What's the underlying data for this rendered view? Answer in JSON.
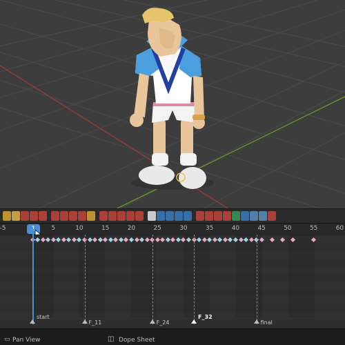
{
  "app": "Blender",
  "viewport": {
    "character": "cartoon man with blond quiff, blue collared polo with white V stripe, white shorts, white sneakers"
  },
  "toolbar": {
    "groups": [
      [
        "lock-icon",
        "key-icon",
        "curve-icon",
        "curve-icon",
        "wave-icon"
      ],
      [
        "link-icon",
        "circle-icon",
        "camera-icon",
        "graph-icon",
        "spark-icon"
      ],
      [
        "record-icon",
        "refresh-icon",
        "refresh-icon",
        "refresh-icon",
        "frame-icon"
      ],
      [
        "bookmark-icon",
        "copy-icon",
        "paste-icon",
        "trash-icon",
        "doc-icon"
      ],
      [
        "grid-icon",
        "bug-icon",
        "dots-icon",
        "sun-icon",
        "globe-icon",
        "arrow-icon",
        "box-icon",
        "box-icon",
        "x-icon"
      ]
    ]
  },
  "ruler": {
    "ticks": [
      "-5",
      "1",
      "5",
      "10",
      "15",
      "20",
      "25",
      "30",
      "35",
      "40",
      "45",
      "50",
      "55",
      "60"
    ],
    "current_frame": "1"
  },
  "markers": [
    {
      "label": "start",
      "frame": 1
    },
    {
      "label": "F_11",
      "frame": 11
    },
    {
      "label": "F_24",
      "frame": 24
    },
    {
      "label": "F_32",
      "frame": 32
    },
    {
      "label": "final",
      "frame": 44
    }
  ],
  "keyframes": {
    "pink": [
      1,
      3,
      5,
      7,
      9,
      11,
      13,
      15,
      17,
      19,
      21,
      23,
      24,
      25,
      26,
      28,
      30,
      32,
      34,
      36,
      38,
      41,
      43,
      45,
      47,
      49,
      51,
      55
    ],
    "blue": [
      2,
      4,
      6,
      8,
      10,
      12,
      14,
      16,
      18,
      20,
      22,
      27,
      29,
      31,
      33,
      35,
      37,
      39,
      40,
      42,
      44
    ]
  },
  "statusbar": {
    "left_label": "Pan View",
    "center_label": "Dope Sheet"
  }
}
